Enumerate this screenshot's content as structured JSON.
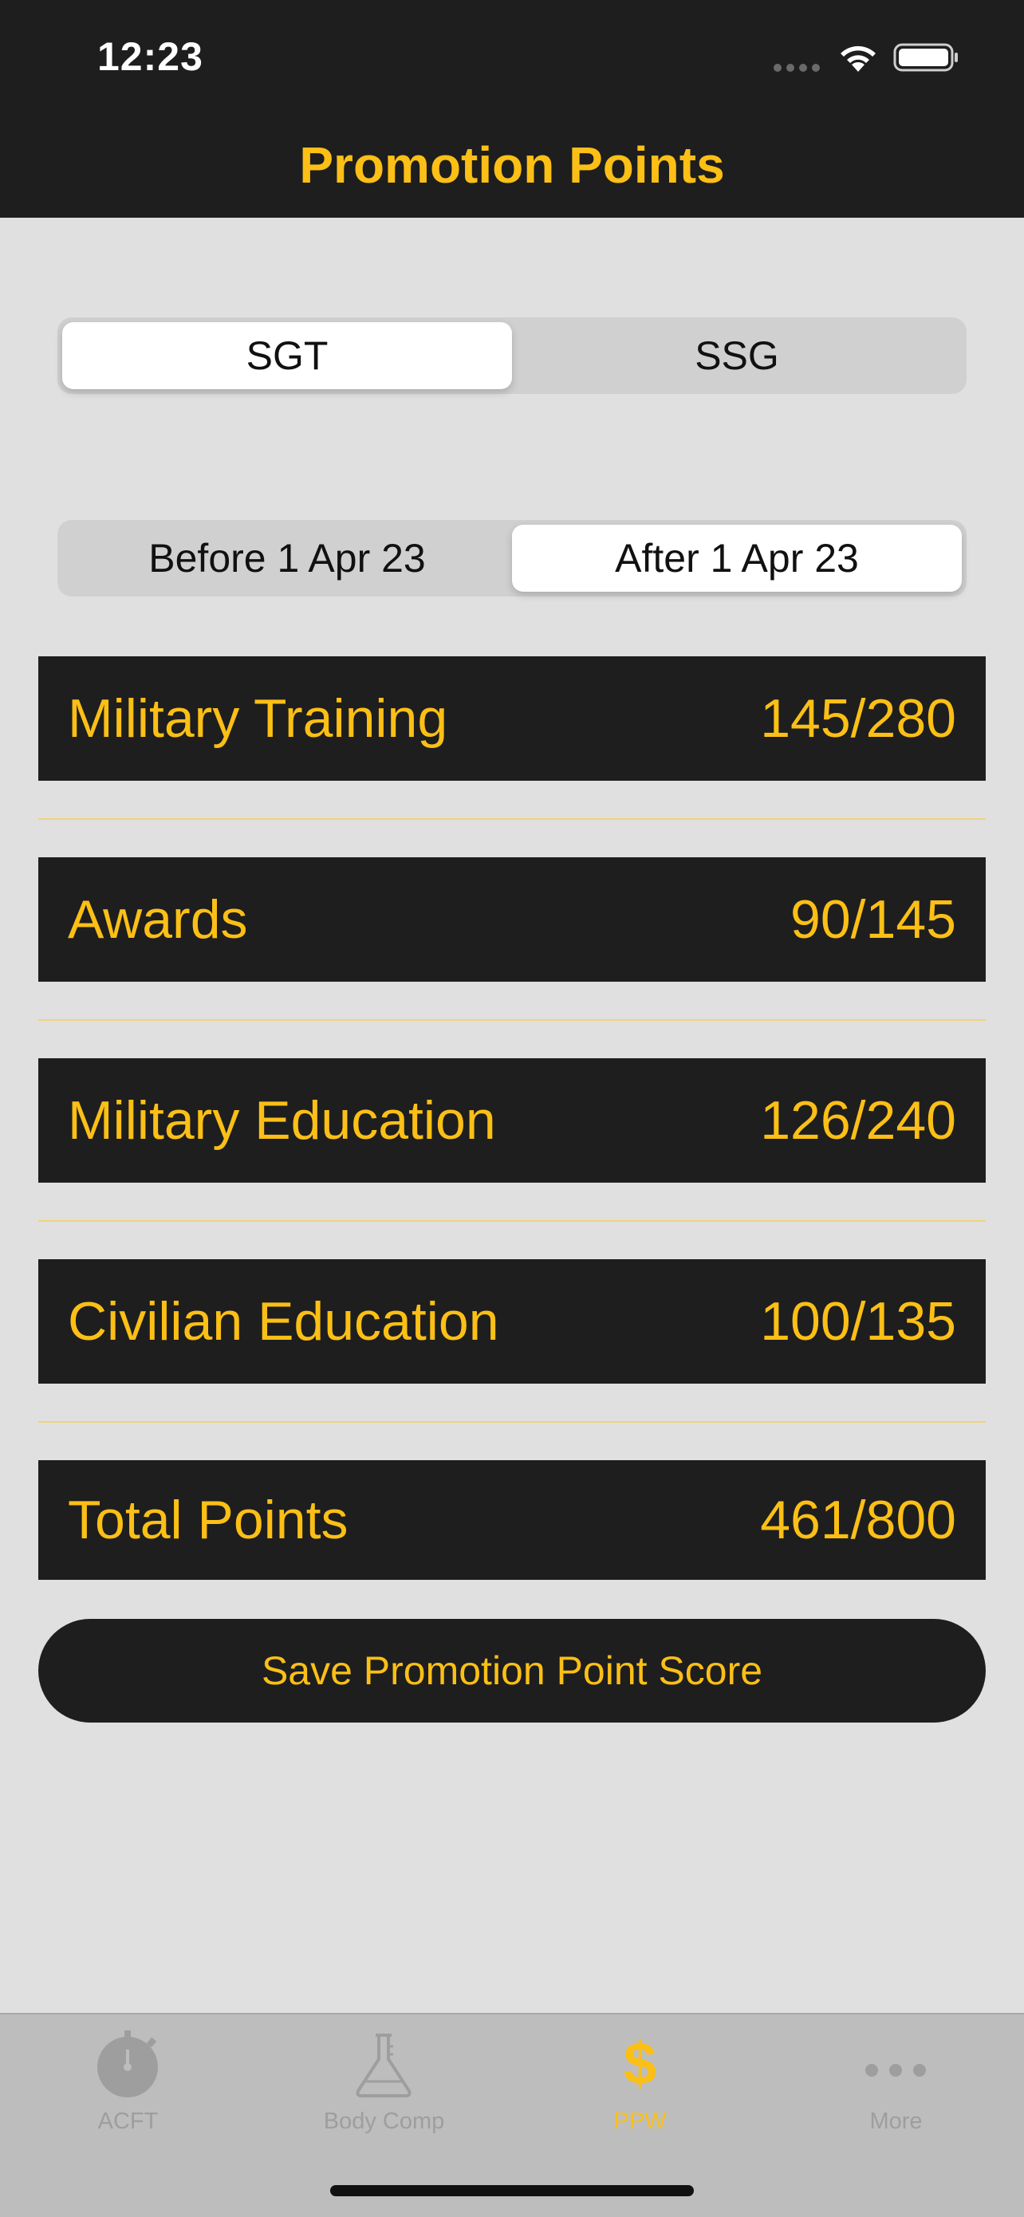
{
  "status": {
    "time": "12:23"
  },
  "nav": {
    "title": "Promotion Points"
  },
  "rank_control": {
    "options": [
      "SGT",
      "SSG"
    ],
    "selected": "SGT"
  },
  "date_control": {
    "options": [
      "Before 1 Apr 23",
      "After 1 Apr 23"
    ],
    "selected": "After 1 Apr 23"
  },
  "categories": [
    {
      "label": "Military Training",
      "value": "145/280"
    },
    {
      "label": "Awards",
      "value": "90/145"
    },
    {
      "label": "Military Education",
      "value": "126/240"
    },
    {
      "label": "Civilian Education",
      "value": "100/135"
    }
  ],
  "total": {
    "label": "Total Points",
    "value": "461/800"
  },
  "save_button": {
    "label": "Save Promotion Point Score"
  },
  "tabs": [
    {
      "label": "ACFT",
      "icon": "stopwatch-icon",
      "active": false
    },
    {
      "label": "Body Comp",
      "icon": "flask-icon",
      "active": false
    },
    {
      "label": "PPW",
      "icon": "dollar-icon",
      "active": true
    },
    {
      "label": "More",
      "icon": "more-dots-icon",
      "active": false
    }
  ],
  "colors": {
    "accent": "#fbbf16",
    "bar_background": "#1e1e1e",
    "page_background": "#e0e0e0",
    "tab_bar_background": "#bdbdbd",
    "tab_inactive": "#9e9e9e"
  }
}
